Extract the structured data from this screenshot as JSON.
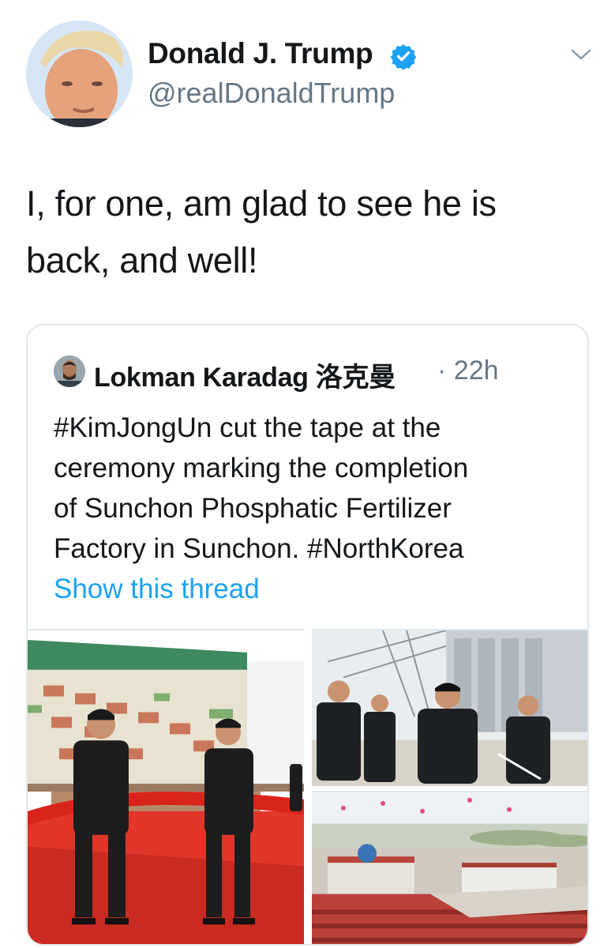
{
  "author": {
    "name": "Donald J. Trump",
    "handle": "@realDonaldTrump",
    "verified": true,
    "avatar": "avatar-photo"
  },
  "tweet": {
    "line1": "I, for one, am glad to see he is",
    "line2": "back, and well!"
  },
  "quote": {
    "author": "Lokman Karadag 洛克曼",
    "separator": "·",
    "time": "22h",
    "lines": [
      "#KimJongUn cut the tape at the",
      "ceremony marking the completion",
      "of Sunchon Phosphatic Fertilizer",
      "Factory in Sunchon. #NorthKorea"
    ],
    "show_thread": "Show this thread"
  },
  "media": [
    {
      "icon": "ribbon-cutting-photo"
    },
    {
      "icon": "factory-visit-photo"
    },
    {
      "icon": "crowd-aerial-photo"
    }
  ],
  "colors": {
    "text": "#14171a",
    "secondary": "#657786",
    "link": "#1da1f2",
    "border": "#e1e8ed",
    "verified": "#1da1f2"
  }
}
